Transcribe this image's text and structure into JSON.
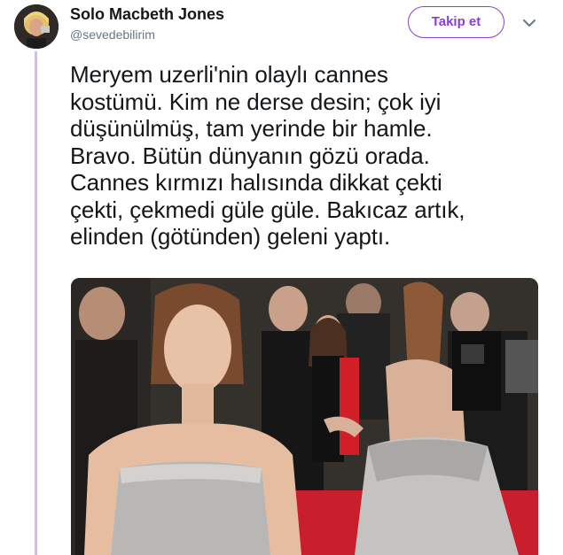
{
  "tweet": {
    "display_name": "Solo Macbeth Jones",
    "handle": "@sevedebilirim",
    "follow_label": "Takip et",
    "text": "Meryem uzerli'nin olaylı cannes\nkostümü. Kim ne derse desin; çok iyi\ndüşünülmüş, tam yerinde bir hamle.\nBravo. Bütün dünyanın gözü orada.\nCannes kırmızı halısında dikkat çekti\nçekti, çekmedi güle güle. Bakıcaz artık,\nelinden (götünden) geleni yaptı."
  },
  "icons": {
    "more": "chevron-down-icon",
    "avatar": "profile-photo"
  },
  "colors": {
    "accent": "#8a3fd0",
    "thread_line": "#d7b8f0",
    "text": "#14171a",
    "secondary": "#657786",
    "carpet": "#c81e2e"
  }
}
